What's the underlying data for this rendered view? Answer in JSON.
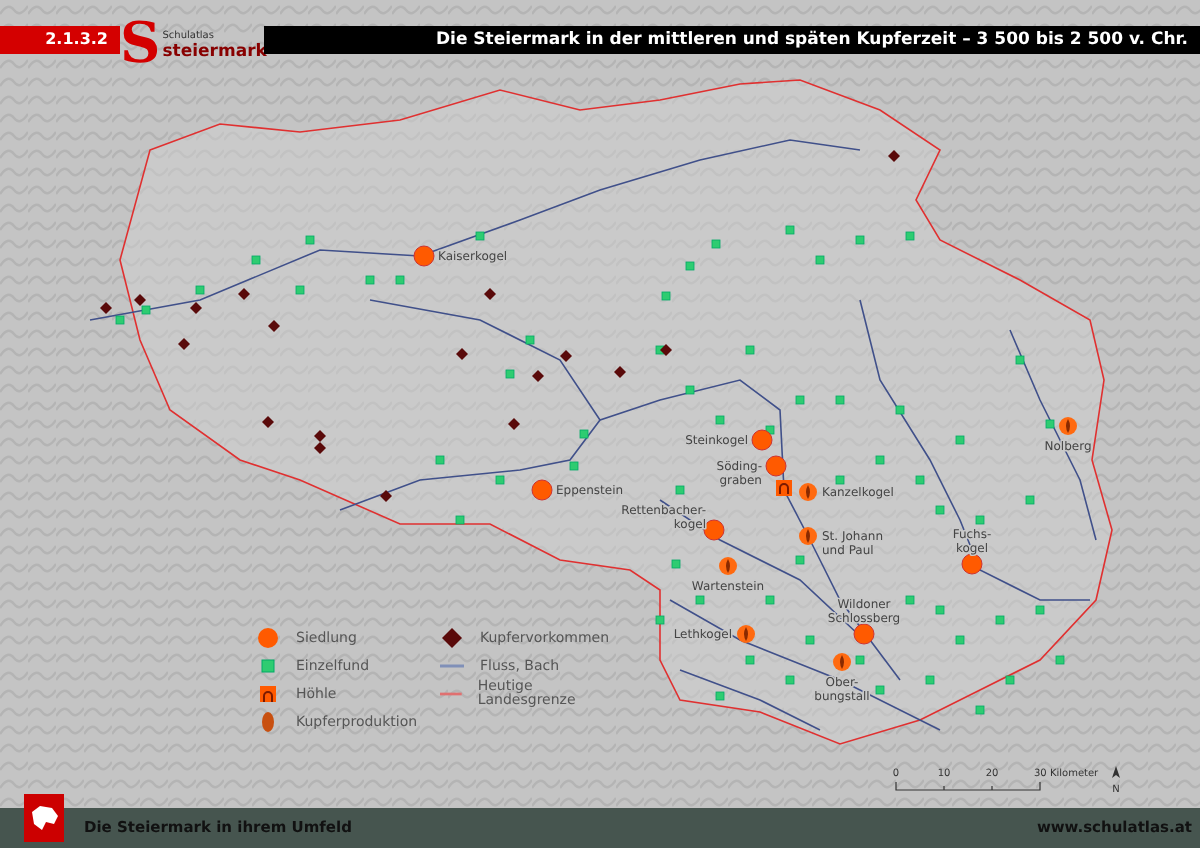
{
  "header": {
    "number": "2.1.3.2",
    "logo": {
      "letter": "S",
      "line1": "Schulatlas",
      "line2": "steiermark"
    },
    "title": "Die Steiermark in der mittleren und späten Kupferzeit – 3 500 bis 2 500 v. Chr."
  },
  "map": {
    "sites": [
      {
        "kind": "siedlung",
        "lines": [
          "Kaiserkogel"
        ]
      },
      {
        "kind": "siedlung",
        "lines": [
          "Eppenstein"
        ]
      },
      {
        "kind": "siedlung",
        "lines": [
          "Steinkogel"
        ]
      },
      {
        "kind": "siedlung",
        "lines": [
          "Söding-",
          "graben"
        ]
      },
      {
        "kind": "hoehle"
      },
      {
        "kind": "produktion",
        "lines": [
          "Kanzelkogel"
        ]
      },
      {
        "kind": "siedlung",
        "lines": [
          "Rettenbacher-",
          "kogel"
        ]
      },
      {
        "kind": "produktion",
        "lines": [
          "St. Johann",
          "und Paul"
        ]
      },
      {
        "kind": "produktion",
        "lines": [
          "Wartenstein"
        ]
      },
      {
        "kind": "produktion",
        "lines": [
          "Lethkogel"
        ]
      },
      {
        "kind": "siedlung",
        "lines": [
          "Wildoner",
          "Schlossberg"
        ]
      },
      {
        "kind": "produktion",
        "lines": [
          "Ober-",
          "bungstall"
        ]
      },
      {
        "kind": "siedlung",
        "lines": [
          "Fuchs-",
          "kogel"
        ]
      },
      {
        "kind": "produktion",
        "lines": [
          "Nolberg"
        ]
      }
    ]
  },
  "legend": [
    {
      "kind": "siedlung",
      "label": "Siedlung"
    },
    {
      "kind": "einzelfund",
      "label": "Einzelfund"
    },
    {
      "kind": "hoehle",
      "label": "Höhle"
    },
    {
      "kind": "produktion",
      "label": "Kupferproduktion"
    },
    {
      "kind": "vorkommen",
      "label": "Kupfervorkommen"
    },
    {
      "kind": "fluss",
      "label": "Fluss, Bach"
    },
    {
      "kind": "grenze",
      "label": "Heutige Landesgrenze"
    }
  ],
  "scale": {
    "ticks": [
      "0",
      "10",
      "20",
      "30 Kilometer"
    ],
    "north": "N"
  },
  "footer": {
    "caption": "Die Steiermark in ihrem Umfeld",
    "url": "www.schulatlas.at"
  }
}
